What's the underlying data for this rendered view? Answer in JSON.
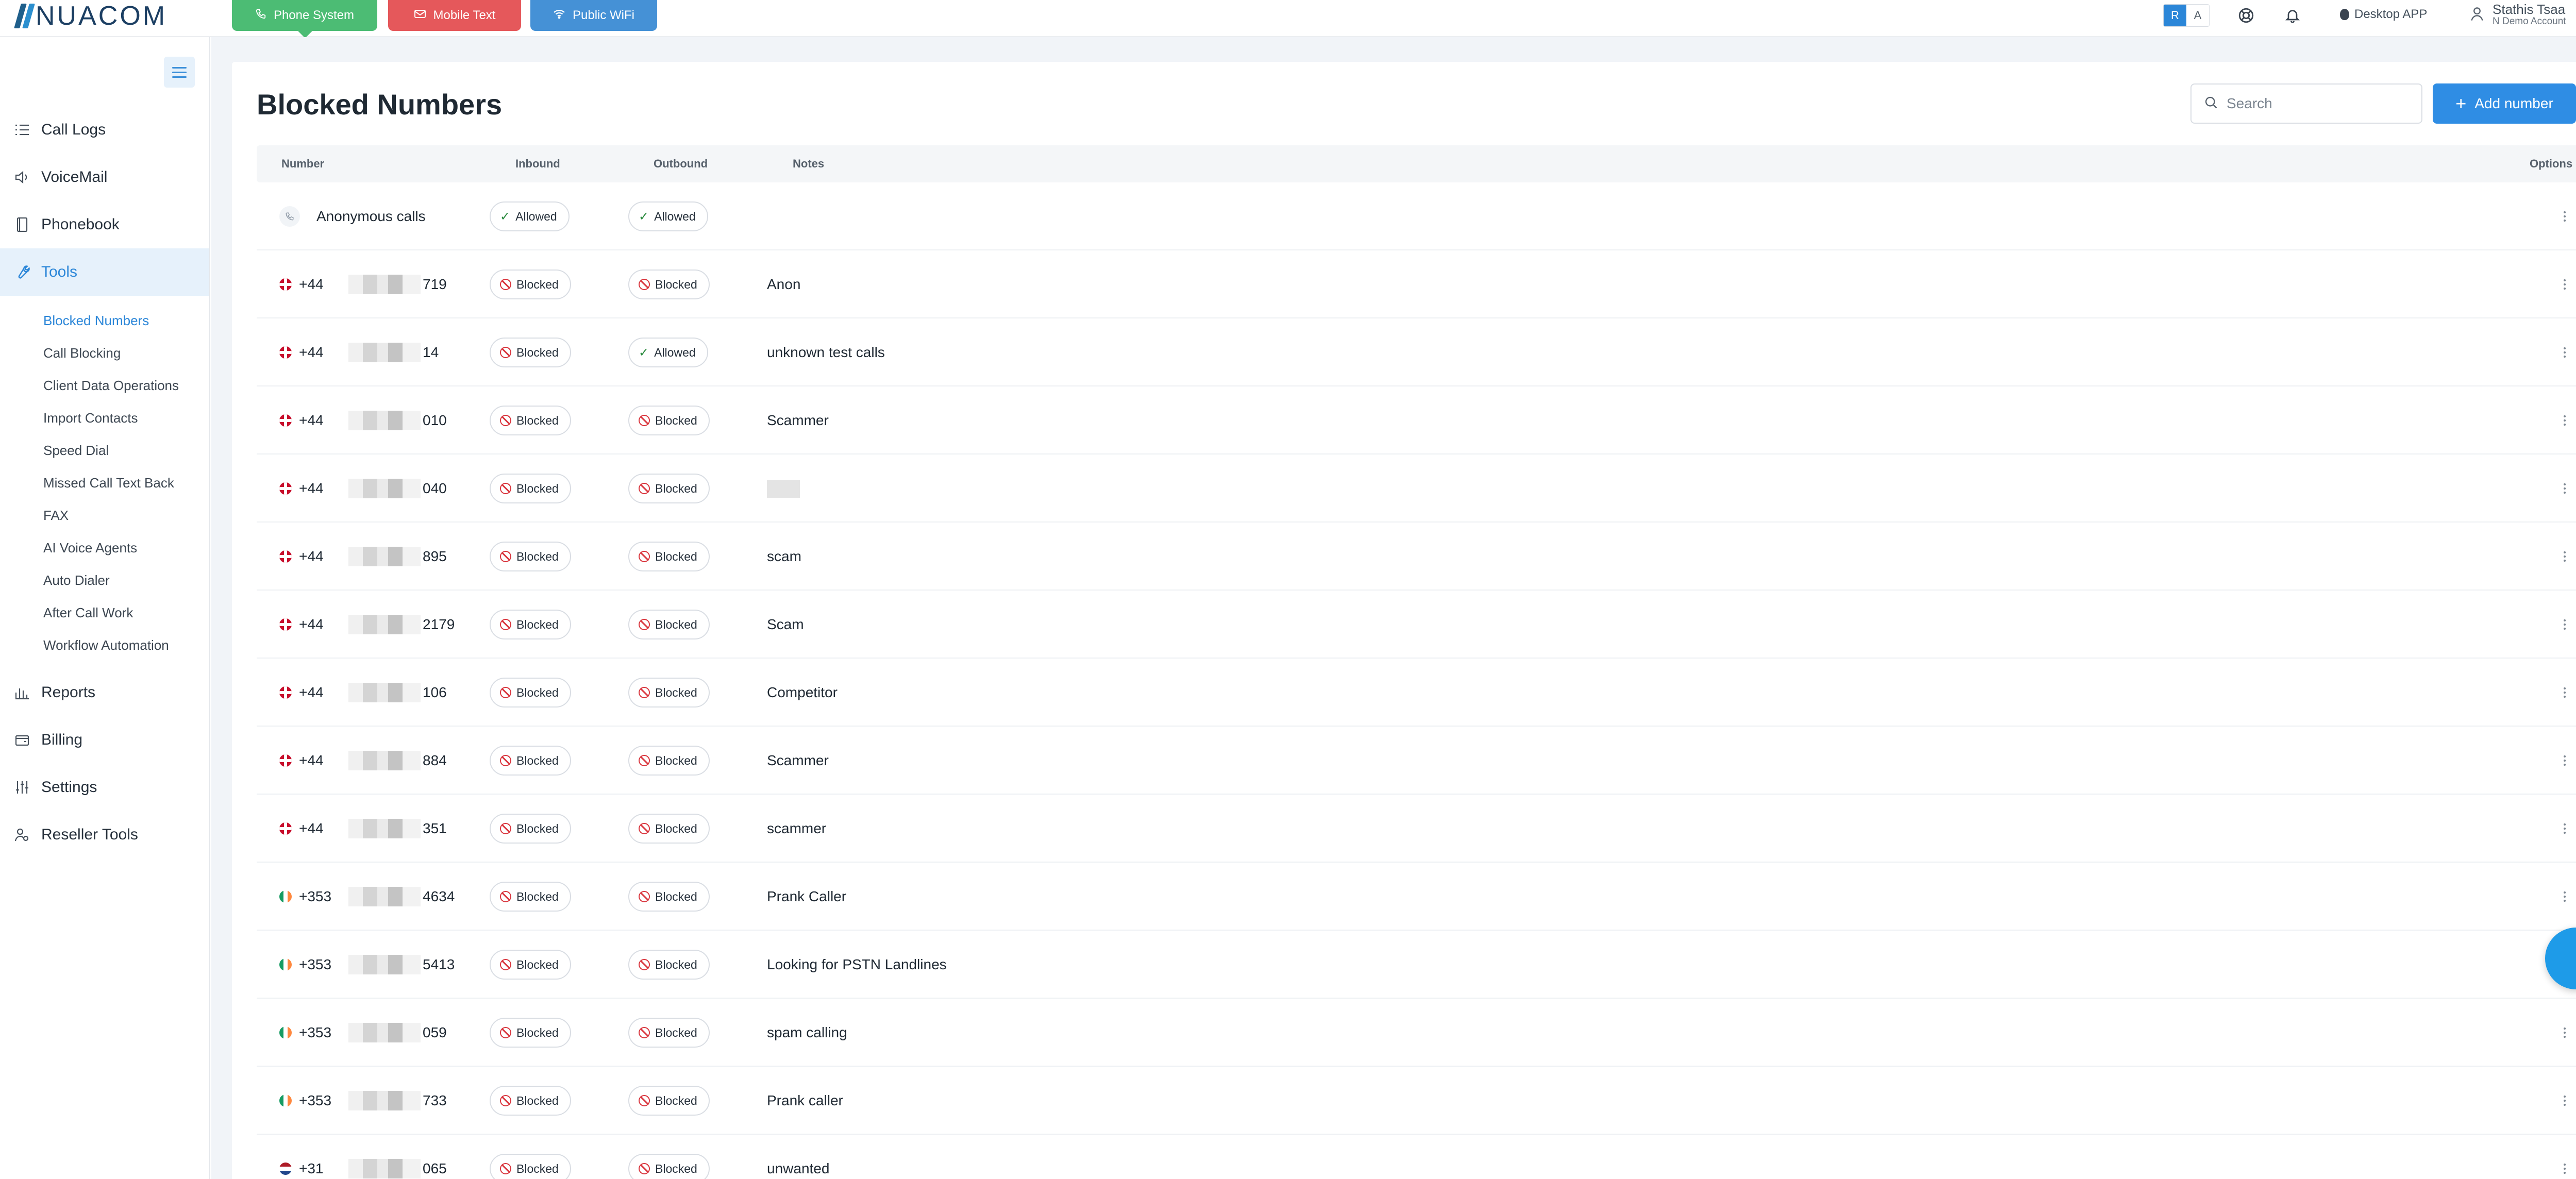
{
  "brand": {
    "logo_text": "NUACOM"
  },
  "product_tabs": [
    {
      "label": "Phone System",
      "icon": "phone-icon"
    },
    {
      "label": "Mobile Text",
      "icon": "mail-icon"
    },
    {
      "label": "Public WiFi",
      "icon": "wifi-icon"
    }
  ],
  "topbar": {
    "lang_active": "R",
    "lang_other": "A",
    "desktop_app_label": "Desktop APP",
    "user_name": "Stathis Tsaa",
    "user_account": "N Demo Account"
  },
  "sidebar": {
    "items": [
      {
        "label": "Call Logs",
        "icon": "list-icon"
      },
      {
        "label": "VoiceMail",
        "icon": "speaker-icon"
      },
      {
        "label": "Phonebook",
        "icon": "book-icon"
      },
      {
        "label": "Tools",
        "icon": "wrench-icon",
        "active": true
      },
      {
        "label": "Reports",
        "icon": "bar-chart-icon"
      },
      {
        "label": "Billing",
        "icon": "wallet-icon"
      },
      {
        "label": "Settings",
        "icon": "sliders-icon"
      },
      {
        "label": "Reseller Tools",
        "icon": "user-group-icon"
      }
    ],
    "tools_subitems": [
      {
        "label": "Blocked Numbers",
        "active": true
      },
      {
        "label": "Call Blocking"
      },
      {
        "label": "Client Data Operations"
      },
      {
        "label": "Import Contacts"
      },
      {
        "label": "Speed Dial"
      },
      {
        "label": "Missed Call Text Back"
      },
      {
        "label": "FAX"
      },
      {
        "label": "AI Voice Agents"
      },
      {
        "label": "Auto Dialer"
      },
      {
        "label": "After Call Work"
      },
      {
        "label": "Workflow Automation"
      }
    ]
  },
  "page": {
    "title": "Blocked Numbers",
    "search_placeholder": "Search",
    "add_button_label": "Add number"
  },
  "table": {
    "columns": {
      "number": "Number",
      "inbound": "Inbound",
      "outbound": "Outbound",
      "notes": "Notes",
      "options": "Options"
    },
    "anonymous_row": {
      "label": "Anonymous calls",
      "inbound": "Allowed",
      "outbound": "Allowed",
      "note": ""
    },
    "rows": [
      {
        "flag": "uk",
        "code": "+44",
        "tail": "719",
        "inbound": "Blocked",
        "outbound": "Blocked",
        "note": "Anon"
      },
      {
        "flag": "uk",
        "code": "+44",
        "tail": "14",
        "inbound": "Blocked",
        "outbound": "Allowed",
        "note": "unknown test calls"
      },
      {
        "flag": "uk",
        "code": "+44",
        "tail": "010",
        "inbound": "Blocked",
        "outbound": "Blocked",
        "note": "Scammer"
      },
      {
        "flag": "uk",
        "code": "+44",
        "tail": "040",
        "inbound": "Blocked",
        "outbound": "Blocked",
        "note": ""
      },
      {
        "flag": "uk",
        "code": "+44",
        "tail": "895",
        "inbound": "Blocked",
        "outbound": "Blocked",
        "note": "scam"
      },
      {
        "flag": "uk",
        "code": "+44",
        "tail": "2179",
        "inbound": "Blocked",
        "outbound": "Blocked",
        "note": "Scam"
      },
      {
        "flag": "uk",
        "code": "+44",
        "tail": "106",
        "inbound": "Blocked",
        "outbound": "Blocked",
        "note": "Competitor"
      },
      {
        "flag": "uk",
        "code": "+44",
        "tail": "884",
        "inbound": "Blocked",
        "outbound": "Blocked",
        "note": "Scammer"
      },
      {
        "flag": "uk",
        "code": "+44",
        "tail": "351",
        "inbound": "Blocked",
        "outbound": "Blocked",
        "note": "scammer"
      },
      {
        "flag": "ie",
        "code": "+353",
        "tail": "4634",
        "inbound": "Blocked",
        "outbound": "Blocked",
        "note": "Prank Caller"
      },
      {
        "flag": "ie",
        "code": "+353",
        "tail": "5413",
        "inbound": "Blocked",
        "outbound": "Blocked",
        "note": "Looking for PSTN Landlines"
      },
      {
        "flag": "ie",
        "code": "+353",
        "tail": "059",
        "inbound": "Blocked",
        "outbound": "Blocked",
        "note": "spam calling"
      },
      {
        "flag": "ie",
        "code": "+353",
        "tail": "733",
        "inbound": "Blocked",
        "outbound": "Blocked",
        "note": "Prank caller"
      },
      {
        "flag": "nl",
        "code": "+31",
        "tail": "065",
        "inbound": "Blocked",
        "outbound": "Blocked",
        "note": "unwanted"
      }
    ]
  },
  "colors": {
    "accent": "#2f8de4",
    "phone_tab": "#4cbc74",
    "mobile_tab": "#e5585b",
    "wifi_tab": "#4591d6",
    "blocked": "#d9363e",
    "allowed": "#2a8a3e"
  }
}
